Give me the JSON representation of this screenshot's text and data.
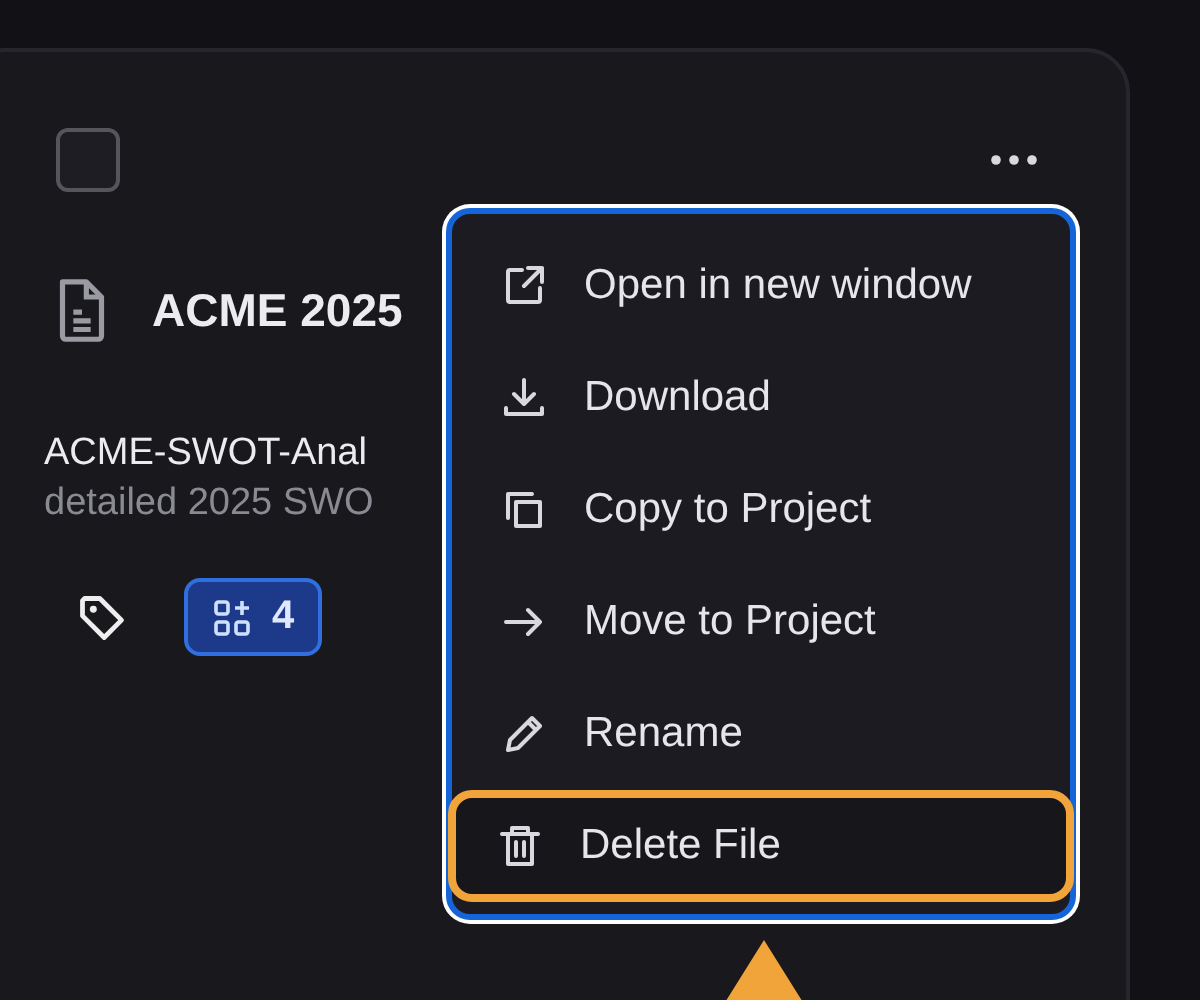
{
  "card": {
    "checked": false,
    "title": "ACME 2025",
    "file_name": "ACME-SWOT-Anal",
    "description": "detailed 2025 SWO",
    "badge_count": "4"
  },
  "menu": {
    "items": [
      {
        "label": "Open in new window",
        "highlighted": false
      },
      {
        "label": "Download",
        "highlighted": false
      },
      {
        "label": "Copy to Project",
        "highlighted": false
      },
      {
        "label": "Move to Project",
        "highlighted": false
      },
      {
        "label": "Rename",
        "highlighted": false
      },
      {
        "label": "Delete File",
        "highlighted": true
      }
    ]
  }
}
